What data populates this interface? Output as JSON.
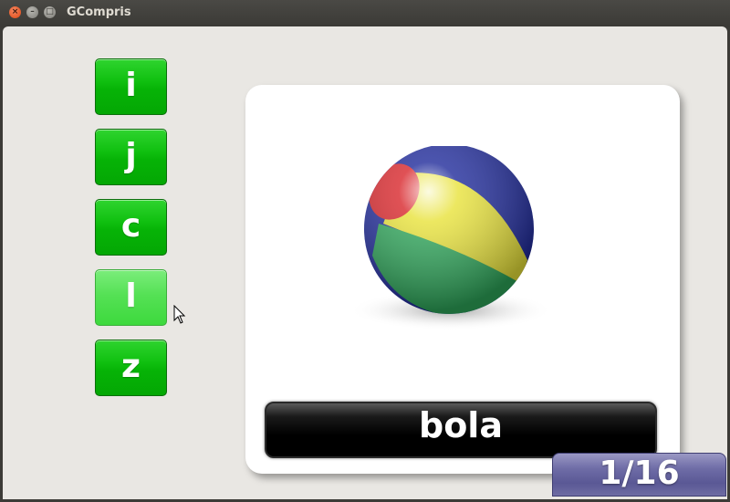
{
  "window": {
    "title": "GCompris"
  },
  "letters": [
    "i",
    "j",
    "c",
    "l",
    "z"
  ],
  "hovered_letter_index": 3,
  "word": "bola",
  "picture": "beach-ball",
  "progress": {
    "label": "1/16",
    "current": 1,
    "total": 16
  },
  "colors": {
    "button_green": "#06b306",
    "button_green_hover": "#55e155",
    "word_bar": "#000000",
    "counter_purple": "#6f6da7",
    "background": "#e9e7e3"
  }
}
